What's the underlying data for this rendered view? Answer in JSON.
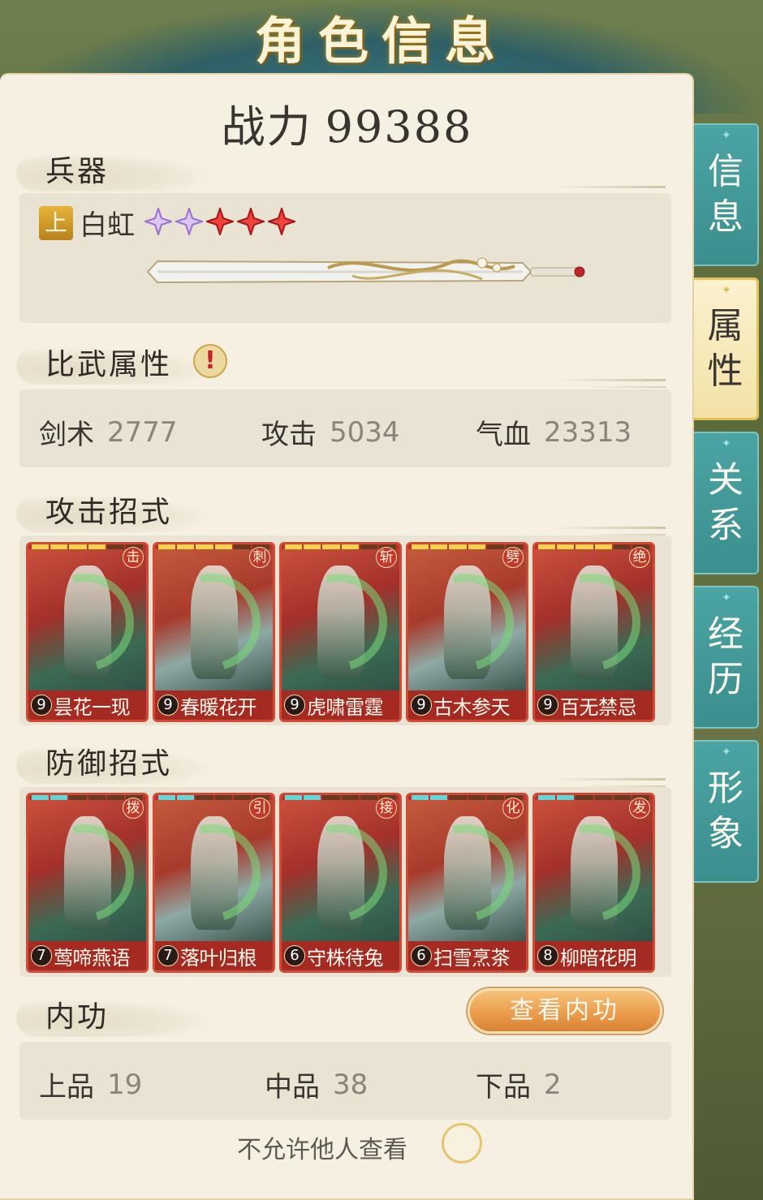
{
  "header": {
    "title": "角色信息"
  },
  "power": {
    "label": "战力",
    "value": "99388"
  },
  "weapon": {
    "section_label": "兵器",
    "grade": "上",
    "name": "白虹",
    "stars": [
      "purple",
      "purple",
      "red",
      "red",
      "red"
    ]
  },
  "duel_attrs": {
    "section_label": "比武属性",
    "alert_icon": "!",
    "stats": [
      {
        "label": "剑术",
        "value": "2777"
      },
      {
        "label": "攻击",
        "value": "5034"
      },
      {
        "label": "气血",
        "value": "23313"
      }
    ]
  },
  "attack_moves": {
    "section_label": "攻击招式",
    "cards": [
      {
        "level": "9",
        "name": "昙花一现",
        "type": "击"
      },
      {
        "level": "9",
        "name": "春暖花开",
        "type": "刺"
      },
      {
        "level": "9",
        "name": "虎啸雷霆",
        "type": "斩"
      },
      {
        "level": "9",
        "name": "古木参天",
        "type": "劈"
      },
      {
        "level": "9",
        "name": "百无禁忌",
        "type": "绝"
      }
    ]
  },
  "defense_moves": {
    "section_label": "防御招式",
    "cards": [
      {
        "level": "7",
        "name": "莺啼燕语",
        "type": "拨"
      },
      {
        "level": "7",
        "name": "落叶归根",
        "type": "引"
      },
      {
        "level": "6",
        "name": "守株待兔",
        "type": "接"
      },
      {
        "level": "6",
        "name": "扫雪烹茶",
        "type": "化"
      },
      {
        "level": "8",
        "name": "柳暗花明",
        "type": "发"
      }
    ]
  },
  "inner_skill": {
    "section_label": "内功",
    "view_button": "查看内功",
    "stats": [
      {
        "label": "上品",
        "value": "19"
      },
      {
        "label": "中品",
        "value": "38"
      },
      {
        "label": "下品",
        "value": "2"
      }
    ]
  },
  "privacy": {
    "label": "不允许他人查看",
    "enabled": false
  },
  "side_tabs": [
    {
      "chars": [
        "信",
        "息"
      ],
      "active": false
    },
    {
      "chars": [
        "属",
        "性"
      ],
      "active": true
    },
    {
      "chars": [
        "关",
        "系"
      ],
      "active": false
    },
    {
      "chars": [
        "经",
        "历"
      ],
      "active": false
    },
    {
      "chars": [
        "形",
        "象"
      ],
      "active": false
    }
  ],
  "colors": {
    "panel": "#f5f0e2",
    "card_red": "#b8342a",
    "tab_teal": "#3b8f8e",
    "tab_active": "#f3e2a6",
    "button_orange": "#e99a4a"
  }
}
